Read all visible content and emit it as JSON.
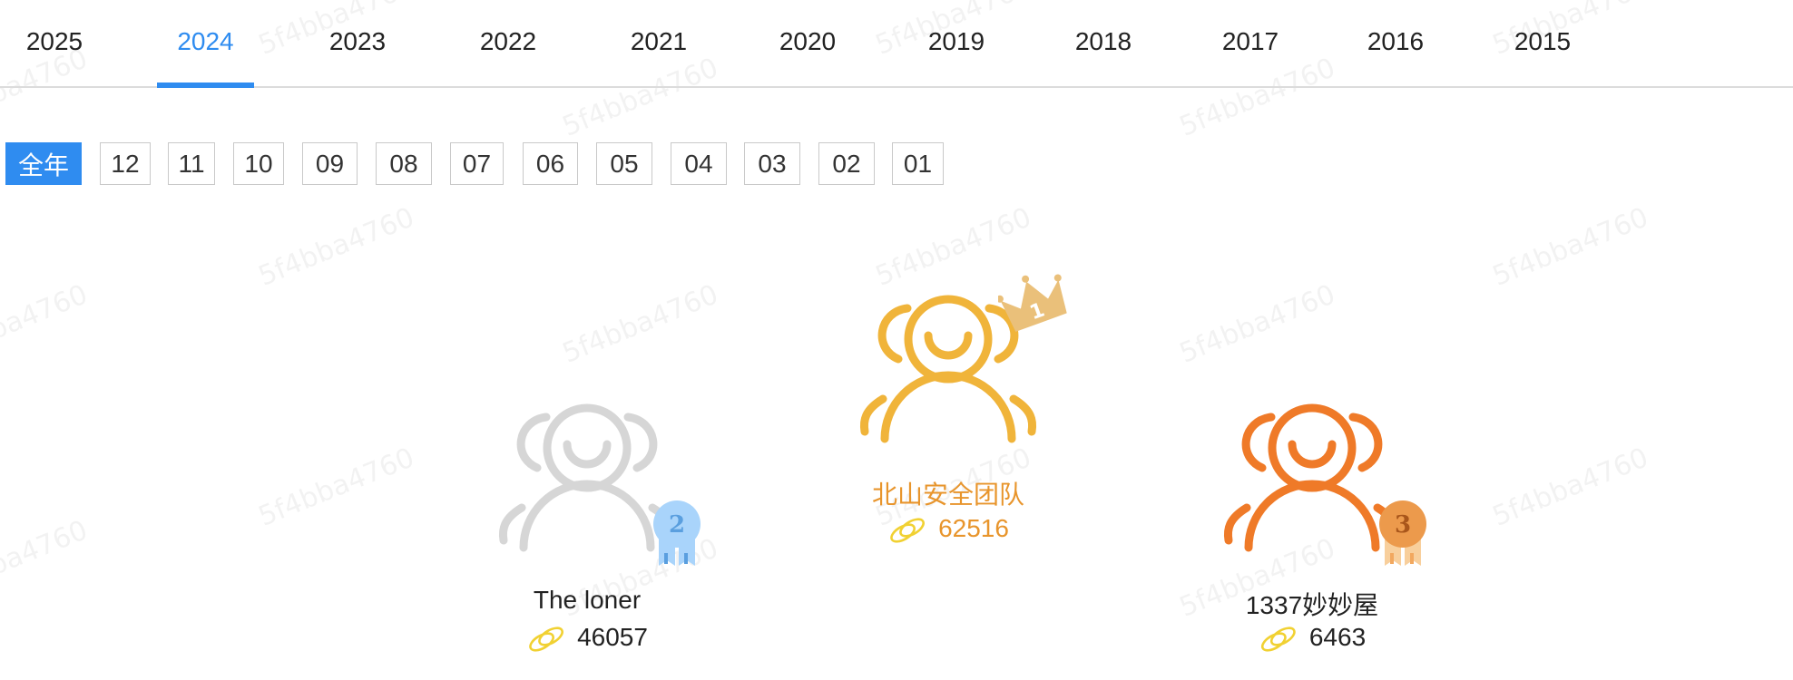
{
  "year_tabs": {
    "items": [
      "2025",
      "2024",
      "2023",
      "2022",
      "2021",
      "2020",
      "2019",
      "2018",
      "2017",
      "2016",
      "2015"
    ],
    "active": "2024"
  },
  "month_filter": {
    "items": [
      "全年",
      "12",
      "11",
      "10",
      "09",
      "08",
      "07",
      "06",
      "05",
      "04",
      "03",
      "02",
      "01"
    ],
    "active": "全年"
  },
  "podium": {
    "first": {
      "rank": "1",
      "name": "北山安全团队",
      "score": "62516",
      "color": "#f0b43a",
      "name_color": "#e8952c",
      "badge_color": "#eac07a"
    },
    "second": {
      "rank": "2",
      "name": "The loner",
      "score": "46057",
      "color": "#d6d6d6",
      "name_color": "#222222",
      "badge_color": "#a9d4fb"
    },
    "third": {
      "rank": "3",
      "name": "1337妙妙屋",
      "score": "6463",
      "color": "#ef7a28",
      "name_color": "#222222",
      "badge_color": "#ec9a4c"
    }
  },
  "icons": {
    "user_group": "users-icon",
    "coin": "coin-icon",
    "crown": "crown-icon",
    "medal": "medal-icon"
  },
  "watermark": "5f4bba4760"
}
